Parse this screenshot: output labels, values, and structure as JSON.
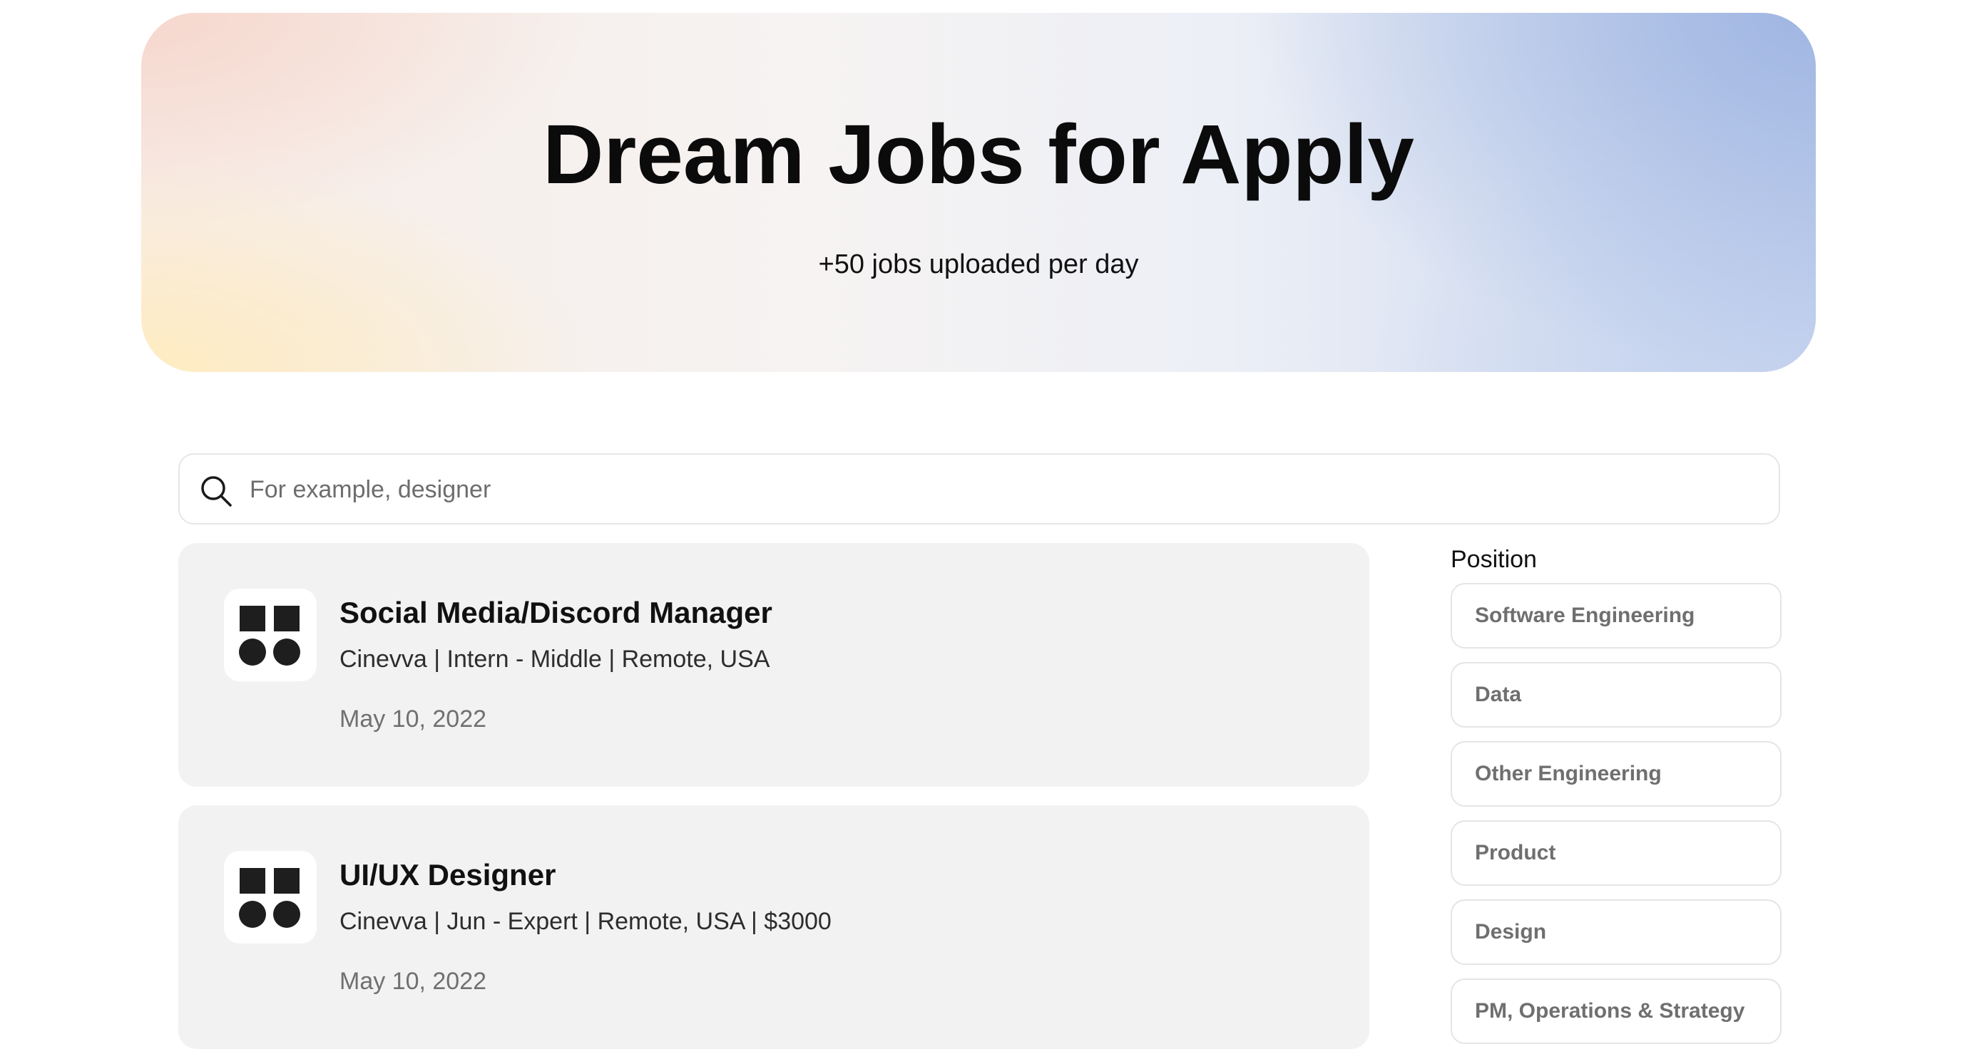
{
  "hero": {
    "title": "Dream Jobs for Apply",
    "subtitle": "+50 jobs uploaded per day"
  },
  "search": {
    "placeholder": "For example, designer",
    "value": "",
    "icon": "search-icon"
  },
  "jobs": [
    {
      "title": "Social Media/Discord Manager",
      "meta": "Cinevva | Intern - Middle | Remote, USA",
      "date": "May 10, 2022",
      "logo_icon": "company-logo-icon"
    },
    {
      "title": "UI/UX Designer",
      "meta": "Cinevva | Jun - Expert | Remote, USA | $3000",
      "date": "May 10, 2022",
      "logo_icon": "company-logo-icon"
    }
  ],
  "filters": {
    "position_label": "Position",
    "options": [
      "Software Engineering",
      "Data",
      "Other Engineering",
      "Product",
      "Design",
      "PM, Operations & Strategy"
    ]
  },
  "colors": {
    "hero_peach": "#f6d6cc",
    "hero_cream": "#ffecbe",
    "hero_blue": "#a0b6e2",
    "card_bg": "#f2f2f2",
    "text_primary": "#111111",
    "text_muted": "#707070",
    "border": "#e5e5e5"
  }
}
